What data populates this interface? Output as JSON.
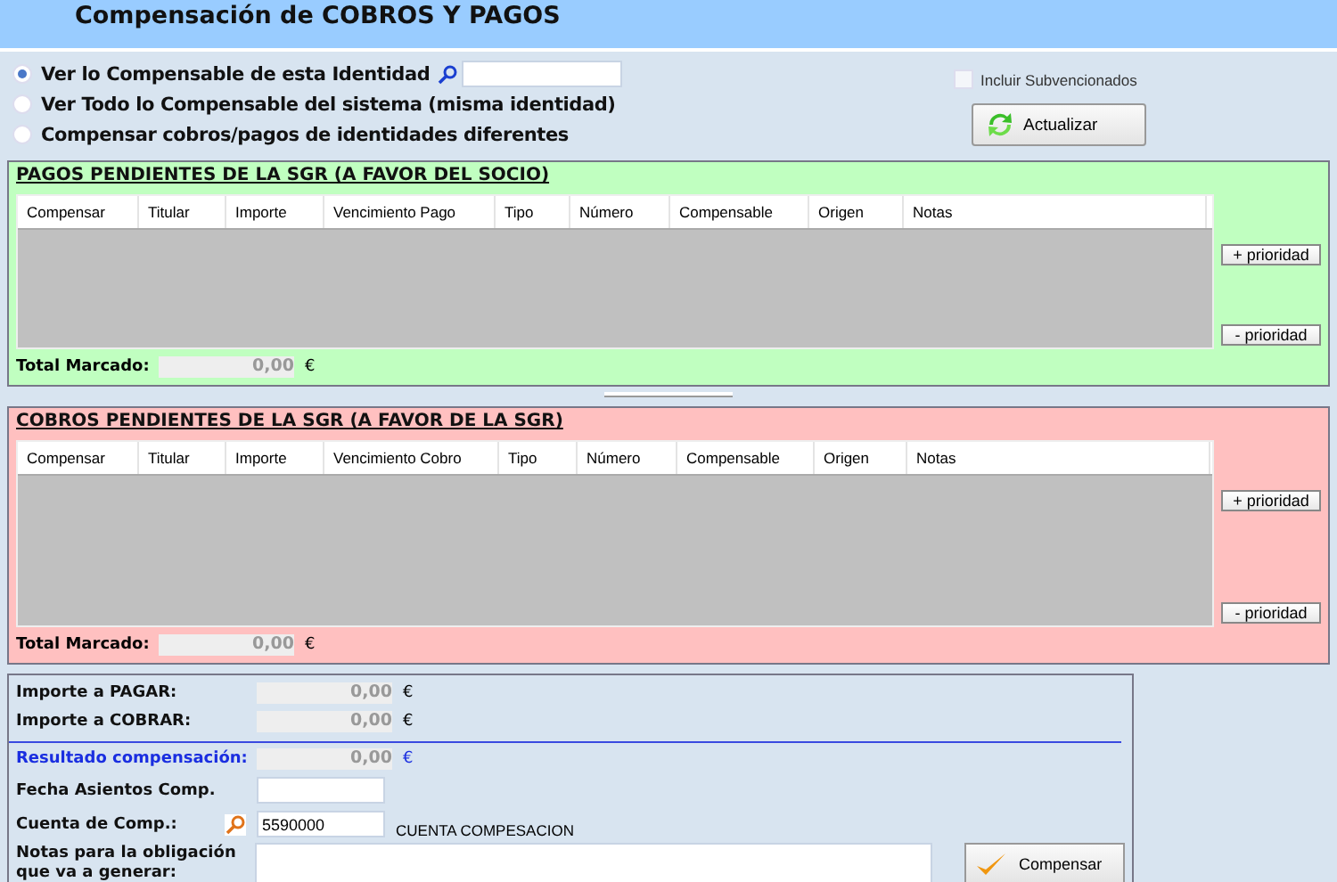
{
  "window": {
    "title": "Compensación de COBROS Y PAGOS"
  },
  "options": [
    {
      "label": "Ver lo Compensable de esta Identidad",
      "selected": true
    },
    {
      "label": "Ver Todo lo Compensable del sistema (misma identidad)",
      "selected": false
    },
    {
      "label": "Compensar cobros/pagos de identidades diferentes",
      "selected": false
    }
  ],
  "include_checkbox": {
    "label": "Incluir Subvencionados",
    "checked": false
  },
  "refresh_button": "Actualizar",
  "panels": [
    {
      "kind": "pagos",
      "title": "PAGOS PENDIENTES DE LA SGR (A FAVOR DEL SOCIO)",
      "columns": [
        "Compensar",
        "Titular",
        "Importe",
        "Vencimiento Pago",
        "Tipo",
        "Número",
        "Compensable",
        "Origen",
        "Notas"
      ],
      "buttons": [
        "+ prioridad",
        "- prioridad"
      ],
      "total_label": "Total Marcado:",
      "total_value": "0,00",
      "currency": "€"
    },
    {
      "kind": "cobros",
      "title": "COBROS PENDIENTES DE LA SGR (A FAVOR DE LA SGR)",
      "columns": [
        "Compensar",
        "Titular",
        "Importe",
        "Vencimiento Cobro",
        "Tipo",
        "Número",
        "Compensable",
        "Origen",
        "Notas"
      ],
      "buttons": [
        "+ prioridad",
        "- prioridad"
      ],
      "total_label": "Total Marcado:",
      "total_value": "0,00",
      "currency": "€"
    }
  ],
  "amounts": [
    {
      "label": "Importe a PAGAR:",
      "value": "0,00",
      "currency": "€"
    },
    {
      "label": "Importe a COBRAR:",
      "value": "0,00",
      "currency": "€"
    }
  ],
  "result": {
    "label": "Resultado compensación:",
    "value": "0,00",
    "currency": "€"
  },
  "date_field": {
    "label": "Fecha Asientos Comp."
  },
  "account_field": {
    "label": "Cuenta de Comp.:",
    "value": "5590000",
    "description": "CUENTA COMPESACION"
  },
  "notes_field": {
    "label": "Notas para la obligación que va a generar:"
  },
  "compensate_button": "Compensar"
}
